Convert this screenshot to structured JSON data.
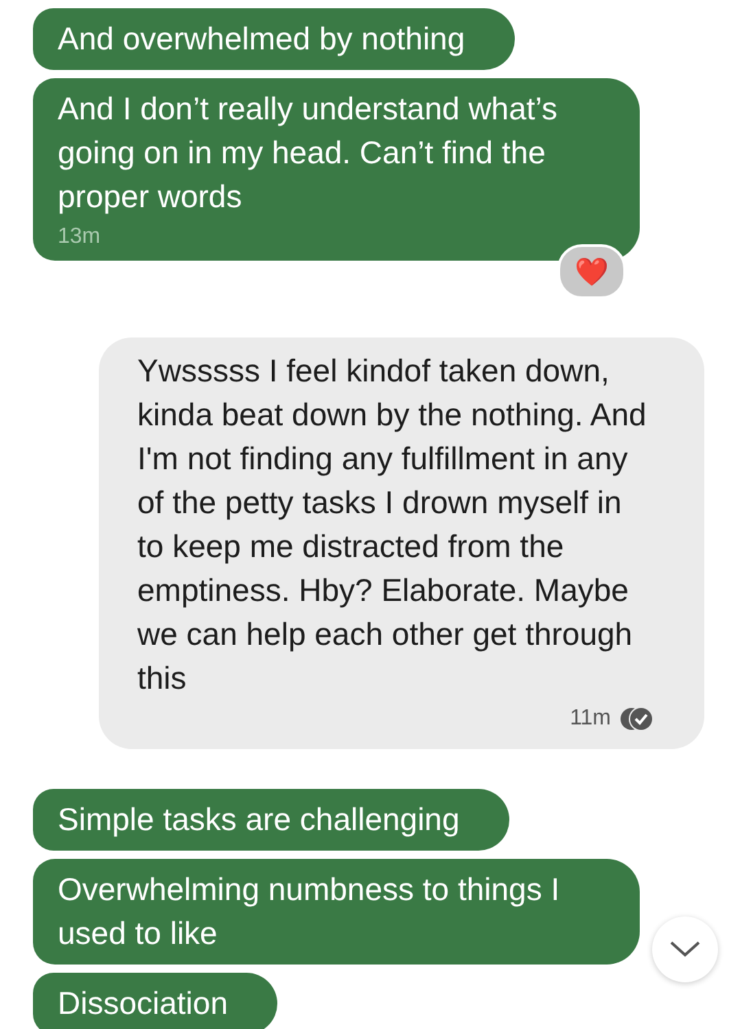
{
  "messages": [
    {
      "kind": "sent",
      "text": "And overwhelmed by nothing"
    },
    {
      "kind": "sent",
      "text": "And I don’t really understand what’s going on in my head. Can’t find the proper words",
      "time": "13m",
      "reaction": "❤️"
    },
    {
      "kind": "received",
      "text": "Ywsssss I feel kindof taken down, kinda beat down by the nothing. And I'm not finding any fulfillment in any of the petty tasks I drown myself in to keep me distracted from the emptiness. Hby? Elaborate. Maybe we can help each other get through this",
      "time": "11m",
      "read": true
    },
    {
      "kind": "sent",
      "text": "Simple tasks are challenging"
    },
    {
      "kind": "sent",
      "text": "Overwhelming numbness to things I used to like"
    },
    {
      "kind": "sent",
      "text": "Dissociation"
    }
  ]
}
